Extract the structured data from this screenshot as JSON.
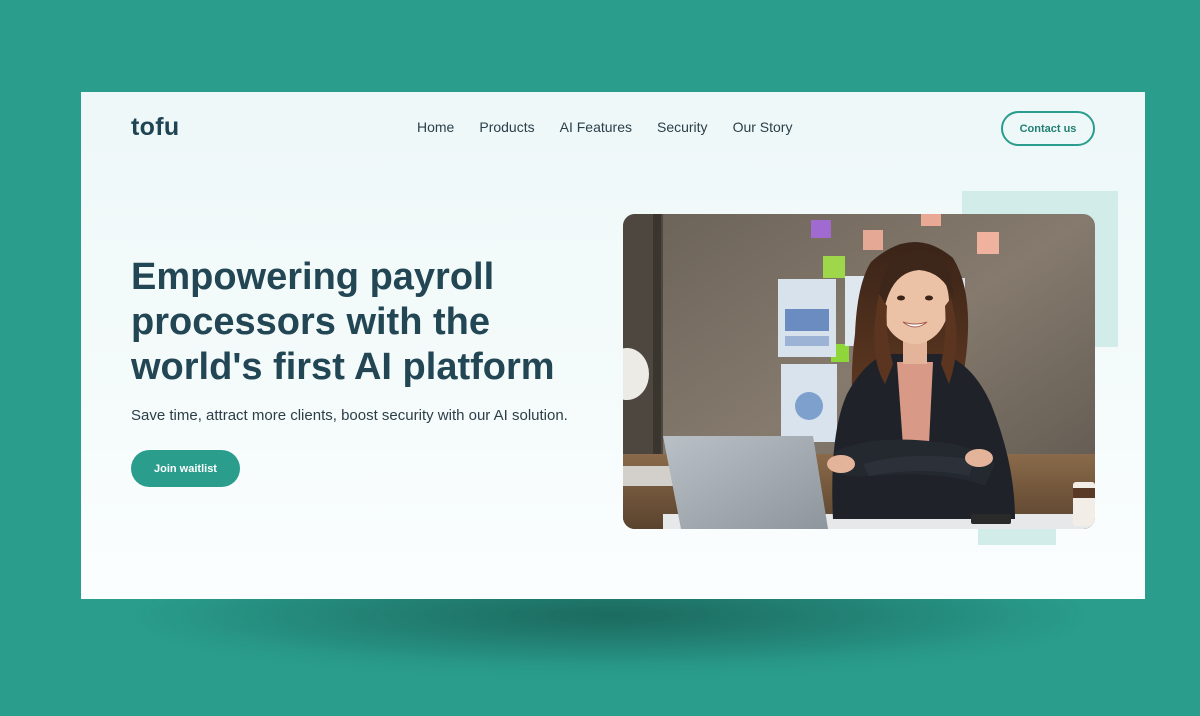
{
  "brand": {
    "logo": "tofu",
    "accent": "#2a9d8c",
    "text_dark": "#224654"
  },
  "nav": {
    "items": [
      {
        "label": "Home"
      },
      {
        "label": "Products"
      },
      {
        "label": "AI Features"
      },
      {
        "label": "Security"
      },
      {
        "label": "Our Story"
      }
    ]
  },
  "header": {
    "contact_label": "Contact us"
  },
  "hero": {
    "headline": "Empowering payroll processors with the world's first AI platform",
    "subtext": "Save time, attract more clients, boost security with our AI solution.",
    "cta_label": "Join waitlist",
    "image_icon": "portrait-photo"
  }
}
